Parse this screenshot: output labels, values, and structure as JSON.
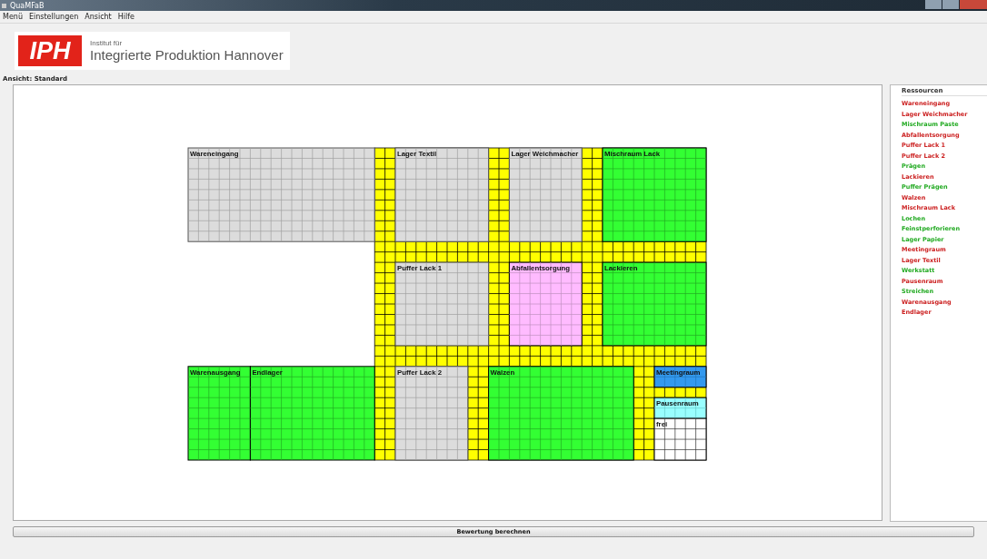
{
  "window": {
    "title": "QuaMFaB"
  },
  "menu": [
    "Menü",
    "Einstellungen",
    "Ansicht",
    "Hilfe"
  ],
  "logo": {
    "mark": "IPH",
    "subtitle": "Institut für",
    "name": "Integrierte Produktion Hannover"
  },
  "view_label": "Ansicht: Standard",
  "rooms": [
    {
      "name": "Wareneingang",
      "kind": "storage"
    },
    {
      "name": "Lager Textil",
      "kind": "storage"
    },
    {
      "name": "Lager Weichmacher",
      "kind": "storage"
    },
    {
      "name": "Mischraum Lack",
      "kind": "production"
    },
    {
      "name": "Puffer Lack 1",
      "kind": "storage"
    },
    {
      "name": "Abfallentsorgung",
      "kind": "waste"
    },
    {
      "name": "Lackieren",
      "kind": "production"
    },
    {
      "name": "Warenausgang",
      "kind": "production"
    },
    {
      "name": "Endlager",
      "kind": "production"
    },
    {
      "name": "Puffer Lack 2",
      "kind": "storage"
    },
    {
      "name": "Walzen",
      "kind": "production"
    },
    {
      "name": "Meetingraum",
      "kind": "meeting"
    },
    {
      "name": "Pausenraum",
      "kind": "break"
    },
    {
      "name": "frei",
      "kind": "free"
    }
  ],
  "resources": {
    "title": "Ressourcen",
    "items": [
      {
        "name": "Wareneingang",
        "color": "#cc2222"
      },
      {
        "name": "Lager Weichmacher",
        "color": "#cc2222"
      },
      {
        "name": "Mischraum Paste",
        "color": "#22aa22"
      },
      {
        "name": "Abfallentsorgung",
        "color": "#cc2222"
      },
      {
        "name": "Puffer Lack 1",
        "color": "#cc2222"
      },
      {
        "name": "Puffer Lack 2",
        "color": "#cc2222"
      },
      {
        "name": "Prägen",
        "color": "#22aa22"
      },
      {
        "name": "Lackieren",
        "color": "#cc2222"
      },
      {
        "name": "Puffer Prägen",
        "color": "#22aa22"
      },
      {
        "name": "Walzen",
        "color": "#cc2222"
      },
      {
        "name": "Mischraum Lack",
        "color": "#cc2222"
      },
      {
        "name": "Lochen",
        "color": "#22aa22"
      },
      {
        "name": "Feinstperforieren",
        "color": "#22aa22"
      },
      {
        "name": "Lager Papier",
        "color": "#22aa22"
      },
      {
        "name": "Meetingraum",
        "color": "#cc2222"
      },
      {
        "name": "Lager Textil",
        "color": "#cc2222"
      },
      {
        "name": "Werkstatt",
        "color": "#22aa22"
      },
      {
        "name": "Pausenraum",
        "color": "#cc2222"
      },
      {
        "name": "Streichen",
        "color": "#22aa22"
      },
      {
        "name": "Warenausgang",
        "color": "#cc2222"
      },
      {
        "name": "Endlager",
        "color": "#cc2222"
      }
    ]
  },
  "evaluate_button": "Bewertung berechnen"
}
